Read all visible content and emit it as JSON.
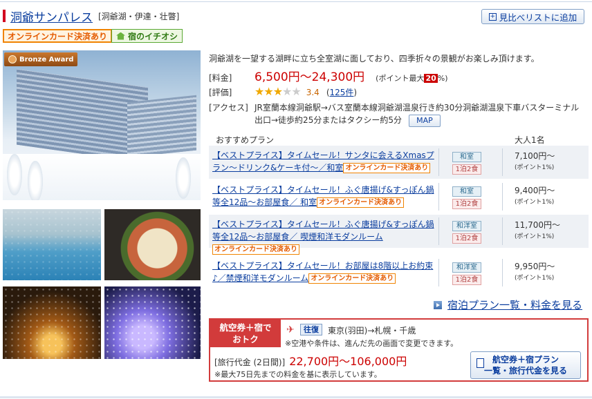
{
  "hotel": {
    "name": "洞爺サンパレス",
    "area": "[洞爺湖・伊達・壮瞥]",
    "compare_button": "見比べリストに追加",
    "badges": {
      "online": "オンラインカード決済あり",
      "osusume": "宿のイチオシ"
    },
    "award": "Bronze Award",
    "description": "洞爺湖を一望する湖畔に立ち全室湖に面しており、四季折々の景観がお楽しみ頂けます。",
    "price_label": "[料金]",
    "price": "6,500円〜24,300円",
    "point_note_prefix": "(ポイント最大",
    "point_max": "20",
    "point_note_suffix": "%)",
    "rating_label": "[評価]",
    "rating_score": "3.4",
    "rating_stars": 3.4,
    "review_count": "125件",
    "access_label": "[アクセス]",
    "access_text": "JR室蘭本線洞爺駅→バス室蘭本線洞爺湖温泉行き約30分洞爺湖温泉下車バスターミナル出口→徒歩約25分またはタクシー約5分",
    "map_button": "MAP"
  },
  "plans": {
    "header_plan": "おすすめプラン",
    "header_price": "大人1名",
    "online_tag": "オンラインカード決済あり",
    "items": [
      {
        "name": "【ベストプライス】タイムセール！サンタに会えるXmasプラン〜ドリンク&ケーキ付〜／和室",
        "room": "和室",
        "meal": "1泊2食",
        "price": "7,100円〜",
        "point": "(ポイント1%)"
      },
      {
        "name": "【ベストプライス】タイムセール！ふぐ唐揚げ&すっぽん鍋等全12品〜お部屋食／ 和室",
        "room": "和室",
        "meal": "1泊2食",
        "price": "9,400円〜",
        "point": "(ポイント1%)"
      },
      {
        "name": "【ベストプライス】タイムセール！ふぐ唐揚げ&すっぽん鍋等全12品〜お部屋食／ 喫煙和洋モダンルーム",
        "room": "和洋室",
        "meal": "1泊2食",
        "price": "11,700円〜",
        "point": "(ポイント1%)"
      },
      {
        "name": "【ベストプライス】タイムセール！お部屋は8階以上お約束♪／禁煙和洋モダンルーム",
        "room": "和洋室",
        "meal": "1泊2食",
        "price": "9,950円〜",
        "point": "(ポイント1%)"
      }
    ],
    "list_link": "宿泊プラン一覧・料金を見る"
  },
  "air": {
    "label_line1": "航空券＋宿で",
    "label_line2": "おトク",
    "round_trip": "往復",
    "route": "東京(羽田)→札幌・千歳",
    "note1": "※空港や条件は、進んだ先の画面で変更できます。",
    "price_label": "[旅行代金 (2日間)]",
    "price": "22,700円〜106,000円",
    "note2": "※最大75日先までの料金を基に表示しています。",
    "button_line1": "航空券＋宿プラン",
    "button_line2": "一覧・旅行代金を見る"
  },
  "colors": {
    "link": "#0a3d9e",
    "price": "#cc0000",
    "accent_red": "#d23b3b",
    "orange": "#f08300"
  },
  "icons": {
    "compare": "plus-box-icon",
    "osusume": "house-icon",
    "air": "airplane-icon",
    "list_link": "arrow-square-icon",
    "air_button": "document-icon"
  }
}
